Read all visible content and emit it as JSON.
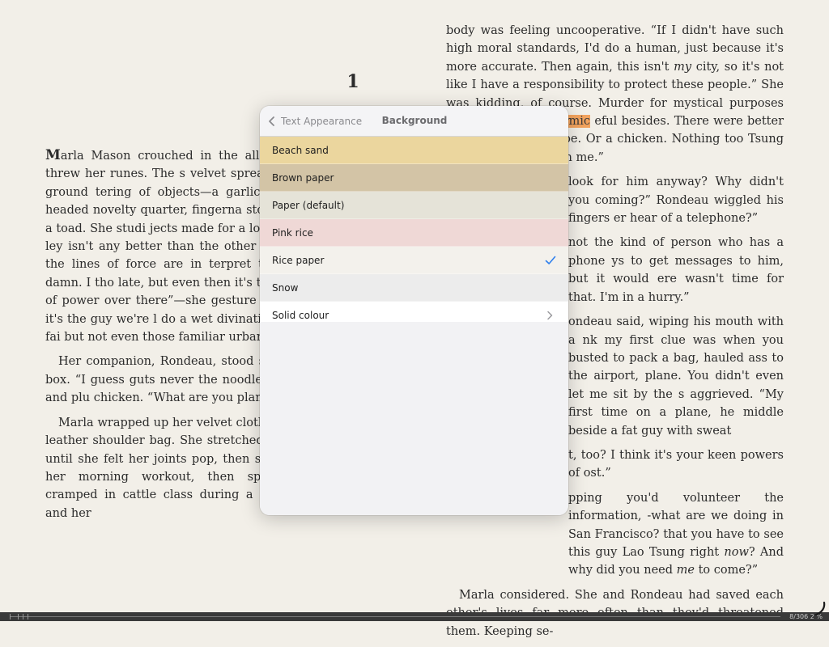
{
  "book": {
    "chapter_number": "1",
    "left_page": {
      "p1_dropcap": "M",
      "p1_a": "arla Mason crouched in the alley be",
      "p1_highlight": "bookstore",
      "p1_b": " and threw her runes. The s velvet spread before her on the ground tering of objects—a garlic clove, a with two-headed novelty quarter, fingerna stone from the head of a toad. She studi jects made for a long time, then sighed ley isn't any better than the other two know where all the lines of force are in terpret the scatter worth a damn. I tho late, but even then it's too vague. There one of power over there”—she gesture “but I don't know if it's the guy we're l do a wet divination.” The air smelled fai but not even those familiar urban smell",
      "p2": "Her companion, Rondeau, stood slurp a waxed-paper box. “I guess guts never the noodles with his chopstick and plu chicken. “What are you planning to evis",
      "p3": "Marla wrapped up her velvet cloth a stowed them in a leather shoulder bag. She stretched her arms overhead until she felt her joints pop, then sighed. She'd missed her morning workout, then spent several hours cramped in cattle class during a cross-country flight, and her"
    },
    "right_page": {
      "p1_a": "body was feeling uncooperative. “If I didn't have such high moral standards, I'd do a human, just because it's more accurate. Then again, this isn't ",
      "p1_em1": "my",
      "p1_b": " city, so it's not like I have a responsibility to protect these people.” She was kidding, of course. Murder for mystical purposes incurred a nasty ",
      "p1_highlight": "karmic",
      "p1_c": " eful besides. There were better uses for A cat, maybe. Or a chicken. Nothing too Tsung is trying to hide from me.”",
      "p2": "look for him anyway? Why didn't you coming?” Rondeau wiggled his fingers er hear of a telephone?”",
      "p3": "not the kind of person who has a phone ys to get messages to him, but it would ere wasn't time for that. I'm in a hurry.”",
      "p4": "ondeau said, wiping his mouth with a nk my first clue was when you busted to pack a bag, hauled ass to the airport, plane. You didn't even let me sit by the s aggrieved. “My first time on a plane, he middle beside a fat guy with sweat",
      "p5": "t, too? I think it's your keen powers of ost.”",
      "p6": "pping you'd volunteer the information, -what are we doing in San Francisco? that you have to see this guy Lao Tsung right ",
      "p6_em": "now",
      "p6_b": "? And why did you need ",
      "p6_em2": "me",
      "p6_c": " to come?”",
      "p7": "Marla considered. She and Rondeau had saved each other's lives far more often than they'd threatened them. Keeping se-"
    }
  },
  "popover": {
    "back_label": "Text Appearance",
    "title": "Background",
    "options": [
      {
        "label": "Beach sand",
        "selected": false
      },
      {
        "label": "Brown paper",
        "selected": false
      },
      {
        "label": "Paper (default)",
        "selected": false
      },
      {
        "label": "Pink rice",
        "selected": false
      },
      {
        "label": "Rice paper",
        "selected": true
      },
      {
        "label": "Snow",
        "selected": false
      },
      {
        "label": "Solid colour",
        "selected": false,
        "has_submenu": true
      }
    ],
    "accent_color": "#2f80ed"
  },
  "footer": {
    "page_indicator": "8/306 2 %"
  },
  "icons": {
    "back": "chevron-left-icon",
    "check": "checkmark-icon",
    "submenu": "chevron-right-icon",
    "page_curl": "page-curl-icon"
  }
}
